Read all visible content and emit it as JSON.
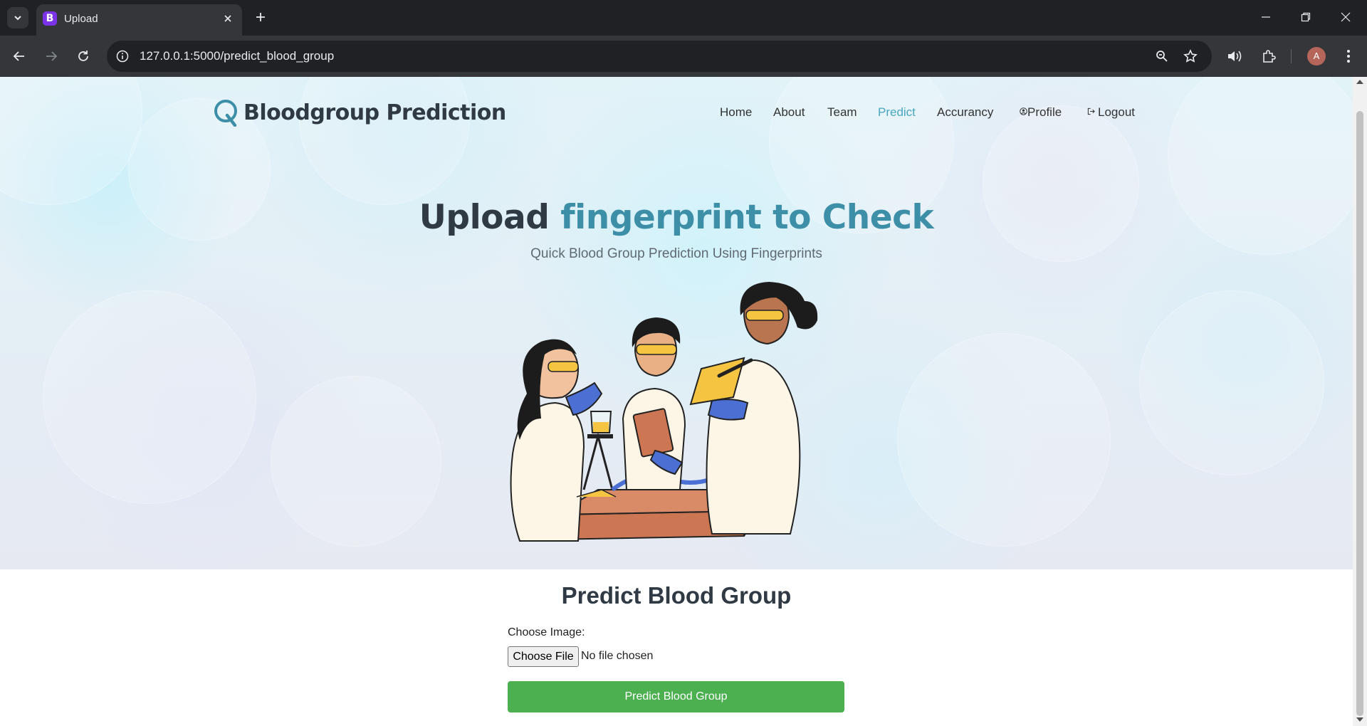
{
  "browser": {
    "tab_title": "Upload",
    "tab_favicon_letter": "B",
    "url": "127.0.0.1:5000/predict_blood_group",
    "profile_initial": "A"
  },
  "site": {
    "brand": "Bloodgroup Prediction",
    "brand_color": "#3d8fa8",
    "nav": [
      {
        "label": "Home",
        "active": false
      },
      {
        "label": "About",
        "active": false
      },
      {
        "label": "Team",
        "active": false
      },
      {
        "label": "Predict",
        "active": true
      },
      {
        "label": "Accurancy",
        "active": false
      },
      {
        "label": "Profile",
        "icon": "user-circle-icon",
        "active": false
      },
      {
        "label": "Logout",
        "icon": "logout-icon",
        "active": false
      }
    ],
    "active_color": "#4aa6c1"
  },
  "hero": {
    "title_plain": "Upload",
    "title_accent": "fingerprint to Check",
    "subtitle": "Quick Blood Group Prediction Using Fingerprints",
    "illustration": "scientists-lab-illustration"
  },
  "form": {
    "title": "Predict Blood Group",
    "file_label": "Choose Image:",
    "file_button": "Choose File",
    "file_status": "No file chosen",
    "submit_label": "Predict Blood Group",
    "submit_color": "#4caf50"
  }
}
